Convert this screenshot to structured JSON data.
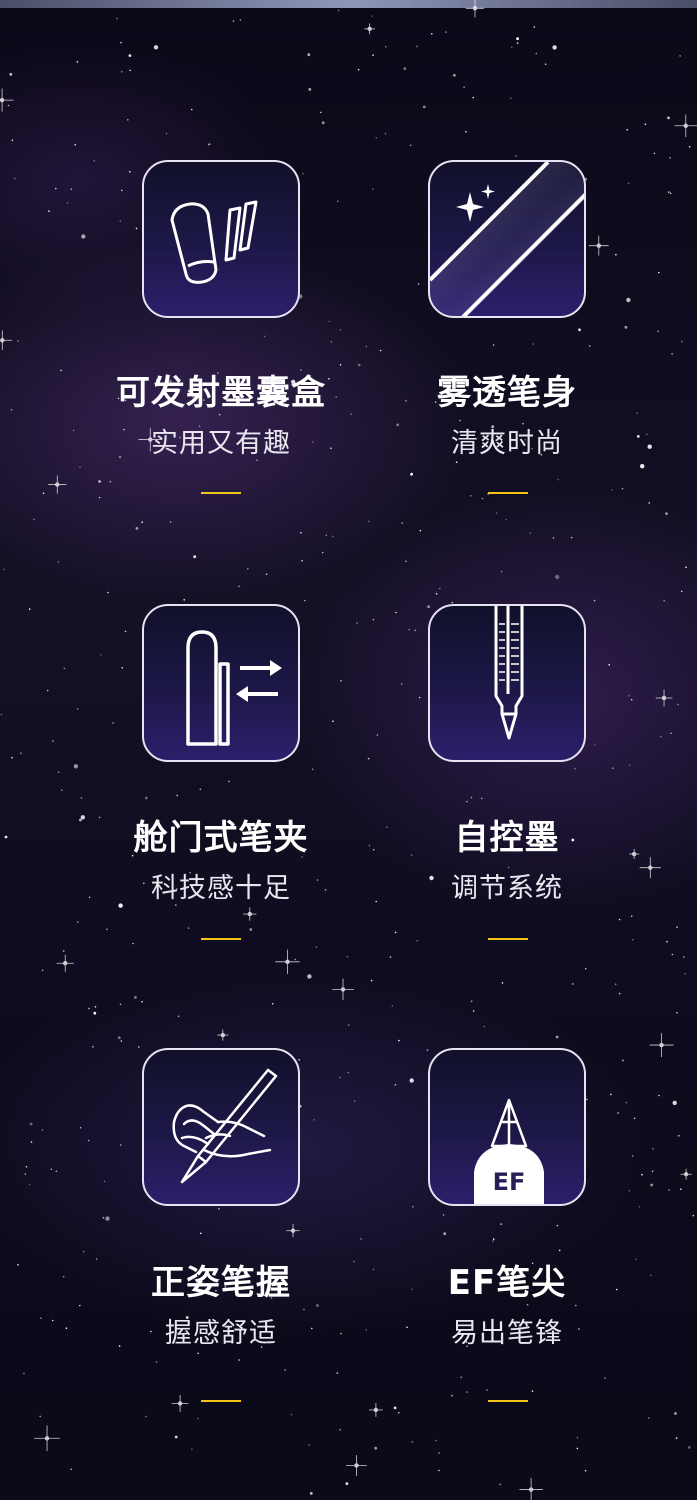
{
  "features": [
    {
      "title": "可发射墨囊盒",
      "subtitle": "实用又有趣",
      "icon": "ink-cartridge-icon"
    },
    {
      "title": "雾透笔身",
      "subtitle": "清爽时尚",
      "icon": "frosted-barrel-icon"
    },
    {
      "title": "舱门式笔夹",
      "subtitle": "科技感十足",
      "icon": "hatch-clip-icon"
    },
    {
      "title": "自控墨",
      "subtitle": "调节系统",
      "icon": "ink-control-icon"
    },
    {
      "title": "正姿笔握",
      "subtitle": "握感舒适",
      "icon": "pen-grip-hand-icon"
    },
    {
      "title": "EF笔尖",
      "subtitle": "易出笔锋",
      "icon": "ef-nib-icon",
      "icon_text": "EF"
    }
  ],
  "colors": {
    "accent": "#f2c41a",
    "icon_border": "#e7e3f2",
    "text": "#ffffff"
  }
}
